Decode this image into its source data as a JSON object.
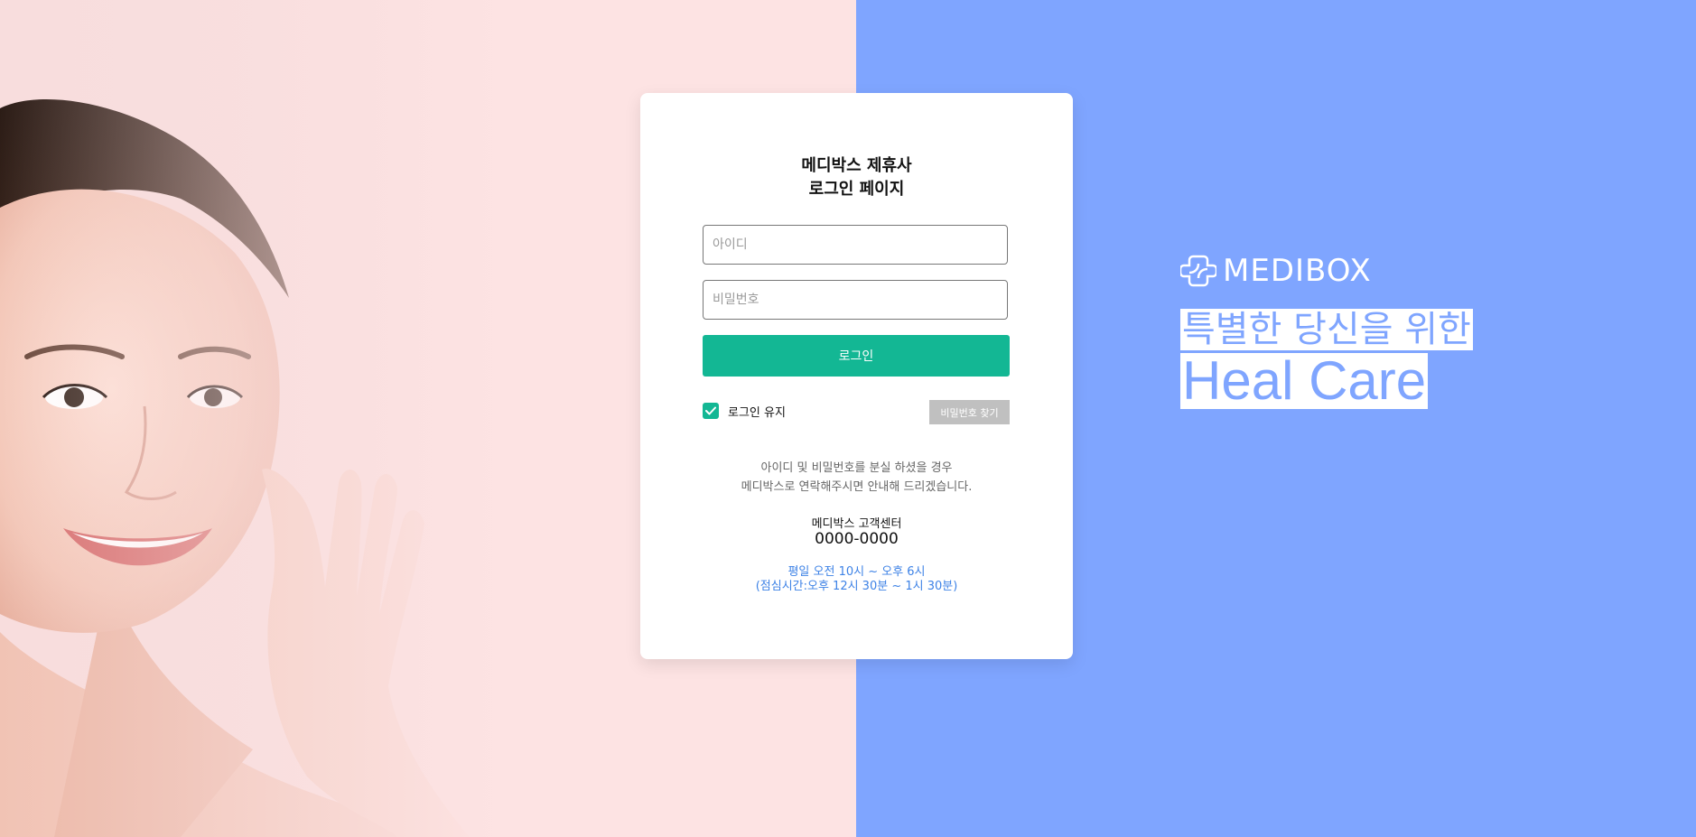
{
  "login": {
    "title_line1": "메디박스 제휴사",
    "title_line2": "로그인 페이지",
    "id_placeholder": "아이디",
    "pw_placeholder": "비밀번호",
    "login_button": "로그인",
    "keep_login_label": "로그인 유지",
    "keep_login_checked": true,
    "find_password_button": "비밀번호 찾기",
    "notice_line1": "아이디 및 비밀번호를 분실 하셨을 경우",
    "notice_line2": "메디박스로 연락해주시면 안내해 드리겠습니다.",
    "cs_label": "메디박스 고객센터",
    "cs_phone": "0000-0000",
    "hours_line1": "평일 오전 10시 ~ 오후 6시",
    "hours_line2": "(점심시간:오후 12시 30분 ~ 1시 30분)"
  },
  "brand": {
    "name": "MEDIBOX",
    "logo_icon": "medical-cross-icon",
    "tagline_line1": "특별한 당신을 위한",
    "tagline_line2": "Heal Care"
  },
  "colors": {
    "left_background": "#fde3e3",
    "right_background": "#7fa5ff",
    "accent_green": "#13b794",
    "find_pw_gray": "#c0c0c0",
    "hours_blue": "#3d82e6"
  },
  "images": {
    "portrait": "smiling-woman-portrait"
  }
}
